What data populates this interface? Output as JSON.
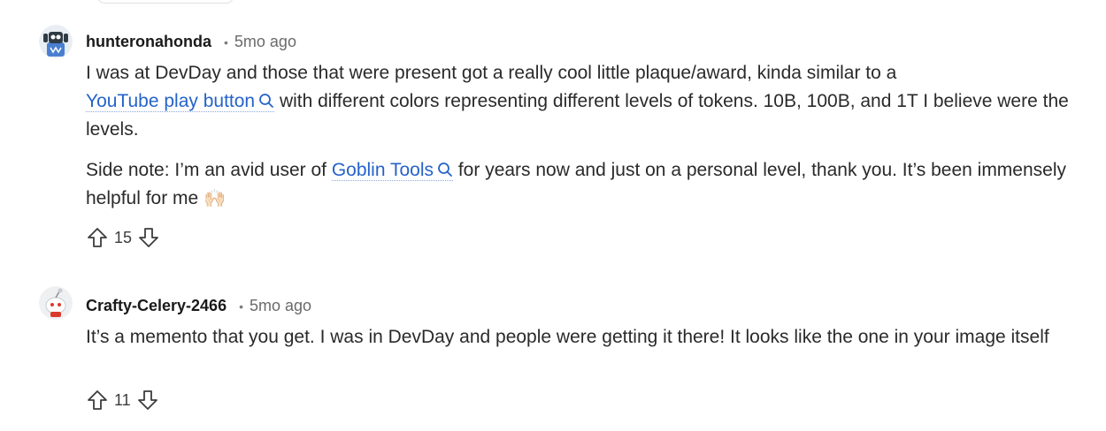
{
  "comments": [
    {
      "author": "hunteronahonda",
      "separator": "•",
      "time": "5mo ago",
      "paragraph1": {
        "text_before": "I was at DevDay and those that were present got a really cool little plaque/award, kinda similar to a ",
        "link": "YouTube play button",
        "text_after": " with different colors representing different levels of tokens. 10B, 100B, and 1T I believe were the levels."
      },
      "paragraph2": {
        "text_before": "Side note: I’m an avid user of ",
        "link": "Goblin Tools",
        "text_after": " for years now and just on a personal level, thank you. It’s been immensely helpful for me ",
        "emoji": "🙌🏻"
      },
      "score": "15",
      "avatar_icon": "robot-avatar-icon"
    },
    {
      "author": "Crafty-Celery-2466",
      "separator": "•",
      "time": "5mo ago",
      "paragraph1": {
        "text": "It’s a memento that you get. I was in DevDay and people were getting it there! It looks like the one in your image itself"
      },
      "score": "11",
      "avatar_icon": "snoo-avatar-icon"
    }
  ],
  "colors": {
    "link": "#2563c9",
    "author": "#1a1a1b",
    "meta": "#6a6a6a"
  }
}
